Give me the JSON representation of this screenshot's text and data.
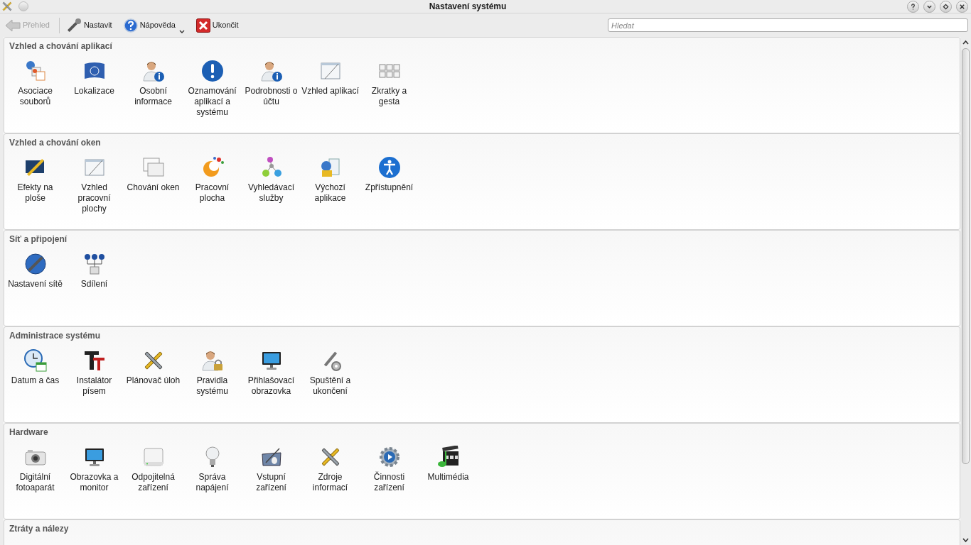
{
  "window": {
    "title": "Nastavení systému"
  },
  "toolbar": {
    "items": [
      {
        "kind": "back",
        "label": "Přehled",
        "disabled": true
      },
      {
        "kind": "configure",
        "label": "Nastavit",
        "disabled": false
      },
      {
        "kind": "help",
        "label": "Nápověda",
        "disabled": false
      },
      {
        "kind": "quit",
        "label": "Ukončit",
        "disabled": false
      }
    ]
  },
  "search": {
    "placeholder": "Hledat"
  },
  "sections": [
    {
      "title": "Vzhled a chování aplikací",
      "items": [
        "Asociace souborů",
        "Lokalizace",
        "Osobní informace",
        "Oznamování aplikací a systému",
        "Podrobnosti o účtu",
        "Vzhled aplikací",
        "Zkratky a gesta"
      ]
    },
    {
      "title": "Vzhled a chování oken",
      "items": [
        "Efekty na ploše",
        "Vzhled pracovní plochy",
        "Chování oken",
        "Pracovní plocha",
        "Vyhledávací služby",
        "Výchozí aplikace",
        "Zpřístupnění"
      ]
    },
    {
      "title": "Síť a připojení",
      "items": [
        "Nastavení sítě",
        "Sdílení"
      ]
    },
    {
      "title": "Administrace systému",
      "items": [
        "Datum a čas",
        "Instalátor písem",
        "Plánovač úloh",
        "Pravidla systému",
        "Přihlašovací obrazovka",
        "Spuštění a ukončení"
      ]
    },
    {
      "title": "Hardware",
      "items": [
        "Digitální fotoaparát",
        "Obrazovka a monitor",
        "Odpojitelná zařízení",
        "Správa napájení",
        "Vstupní zařízení",
        "Zdroje informací",
        "Činnosti zařízení",
        "Multimédia"
      ]
    },
    {
      "title": "Ztráty a nálezy"
    }
  ]
}
